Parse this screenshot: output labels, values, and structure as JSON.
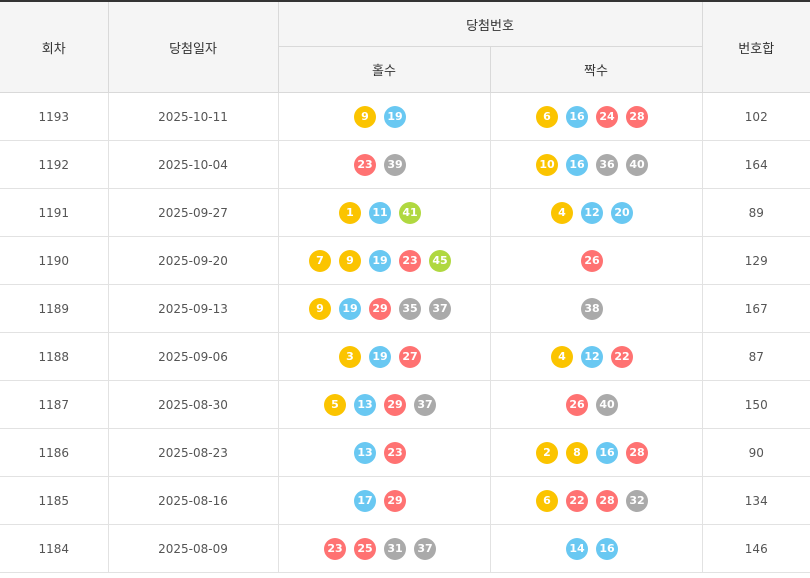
{
  "header": {
    "round": "회차",
    "date": "당첨일자",
    "winning_numbers": "당첨번호",
    "odd": "홀수",
    "even": "짝수",
    "sum": "번호합"
  },
  "ball_colors": {
    "yellow": "#fbc400",
    "blue": "#69c8f2",
    "red": "#ff7272",
    "gray": "#aaaaaa",
    "green": "#b0d840"
  },
  "rows": [
    {
      "round": "1193",
      "date": "2025-10-11",
      "odd": [
        "9",
        "19"
      ],
      "even": [
        "6",
        "16",
        "24",
        "28"
      ],
      "sum": "102"
    },
    {
      "round": "1192",
      "date": "2025-10-04",
      "odd": [
        "23",
        "39"
      ],
      "even": [
        "10",
        "16",
        "36",
        "40"
      ],
      "sum": "164"
    },
    {
      "round": "1191",
      "date": "2025-09-27",
      "odd": [
        "1",
        "11",
        "41"
      ],
      "even": [
        "4",
        "12",
        "20"
      ],
      "sum": "89"
    },
    {
      "round": "1190",
      "date": "2025-09-20",
      "odd": [
        "7",
        "9",
        "19",
        "23",
        "45"
      ],
      "even": [
        "26"
      ],
      "sum": "129"
    },
    {
      "round": "1189",
      "date": "2025-09-13",
      "odd": [
        "9",
        "19",
        "29",
        "35",
        "37"
      ],
      "even": [
        "38"
      ],
      "sum": "167"
    },
    {
      "round": "1188",
      "date": "2025-09-06",
      "odd": [
        "3",
        "19",
        "27"
      ],
      "even": [
        "4",
        "12",
        "22"
      ],
      "sum": "87"
    },
    {
      "round": "1187",
      "date": "2025-08-30",
      "odd": [
        "5",
        "13",
        "29",
        "37"
      ],
      "even": [
        "26",
        "40"
      ],
      "sum": "150"
    },
    {
      "round": "1186",
      "date": "2025-08-23",
      "odd": [
        "13",
        "23"
      ],
      "even": [
        "2",
        "8",
        "16",
        "28"
      ],
      "sum": "90"
    },
    {
      "round": "1185",
      "date": "2025-08-16",
      "odd": [
        "17",
        "29"
      ],
      "even": [
        "6",
        "22",
        "28",
        "32"
      ],
      "sum": "134"
    },
    {
      "round": "1184",
      "date": "2025-08-09",
      "odd": [
        "23",
        "25",
        "31",
        "37"
      ],
      "even": [
        "14",
        "16"
      ],
      "sum": "146"
    }
  ]
}
